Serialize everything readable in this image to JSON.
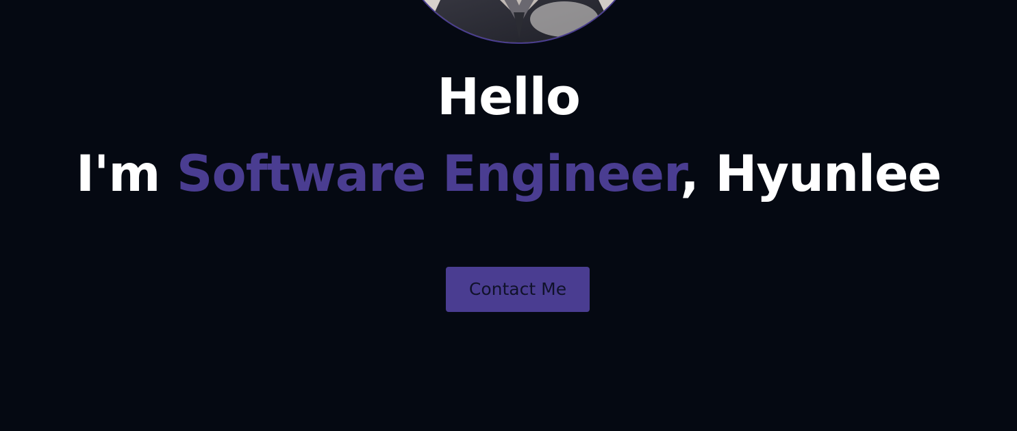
{
  "hero": {
    "greeting": "Hello",
    "headline_prefix": "I'm ",
    "headline_role": "Software Engineer",
    "headline_suffix": ", Hyunlee",
    "contact_label": "Contact Me"
  },
  "colors": {
    "background": "#050912",
    "accent": "#4a3d91",
    "text": "#ffffff",
    "button_text": "#10122a"
  }
}
